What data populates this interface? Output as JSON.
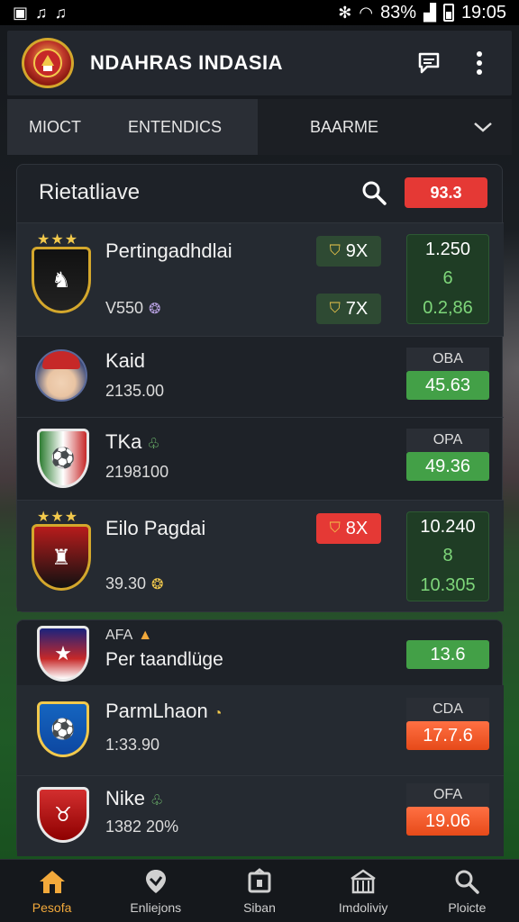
{
  "status_bar": {
    "left_icons": [
      "photo-icon",
      "bell-icon",
      "bell-icon"
    ],
    "battery_text": "83%",
    "time": "19:05"
  },
  "header": {
    "title": "NDAHRAS INDASIA",
    "logo_icon": "club-crest-logo",
    "chat_icon": "message-icon",
    "menu_icon": "more-vertical-icon"
  },
  "tabs": {
    "items": [
      "MIOCT",
      "ENTENDICS",
      "BAARME"
    ],
    "dropdown_icon": "chevron-down-icon"
  },
  "panel": {
    "title": "Rietatliave",
    "badge": "93.3",
    "rows": [
      {
        "name": "Pertingadhdlai",
        "sub": "V550",
        "pill_top": "9X",
        "pill_bottom": "7X",
        "odds_top": "1.250",
        "odds_mid": "6",
        "odds_bot": "0.2,86"
      },
      {
        "name": "Kaid",
        "sub": "2135.00",
        "quote_label": "OBA",
        "quote_value": "45.63"
      },
      {
        "name": "TKa",
        "sub": "2198100",
        "quote_label": "OPA",
        "quote_value": "49.36"
      },
      {
        "name": "Eilo Pagdai",
        "sub": "39.30",
        "pill_top": "8X",
        "odds_top": "10.240",
        "odds_mid": "8",
        "odds_bot": "10.305"
      }
    ]
  },
  "panel2": {
    "rows": [
      {
        "tag": "AFA",
        "name": "Per taandlüge",
        "quote_value": "13.6"
      },
      {
        "name": "ParmLhaon",
        "sub": "1:33.90",
        "quote_label": "CDA",
        "quote_value": "17.7.6"
      },
      {
        "name": "Nike",
        "sub": "1382 20%",
        "quote_label": "OFA",
        "quote_value": "19.06"
      }
    ]
  },
  "bottom_nav": {
    "items": [
      {
        "label": "Pesofa",
        "icon": "home-icon"
      },
      {
        "label": "Enliejons",
        "icon": "map-pin-icon"
      },
      {
        "label": "Siban",
        "icon": "puzzle-icon"
      },
      {
        "label": "Imdoliviy",
        "icon": "building-icon"
      },
      {
        "label": "Ploicte",
        "icon": "search-icon"
      }
    ]
  },
  "colors": {
    "accent": "#f2a93b",
    "badge_red": "#e53935",
    "green": "#43a047",
    "orange": "#e64a19"
  }
}
